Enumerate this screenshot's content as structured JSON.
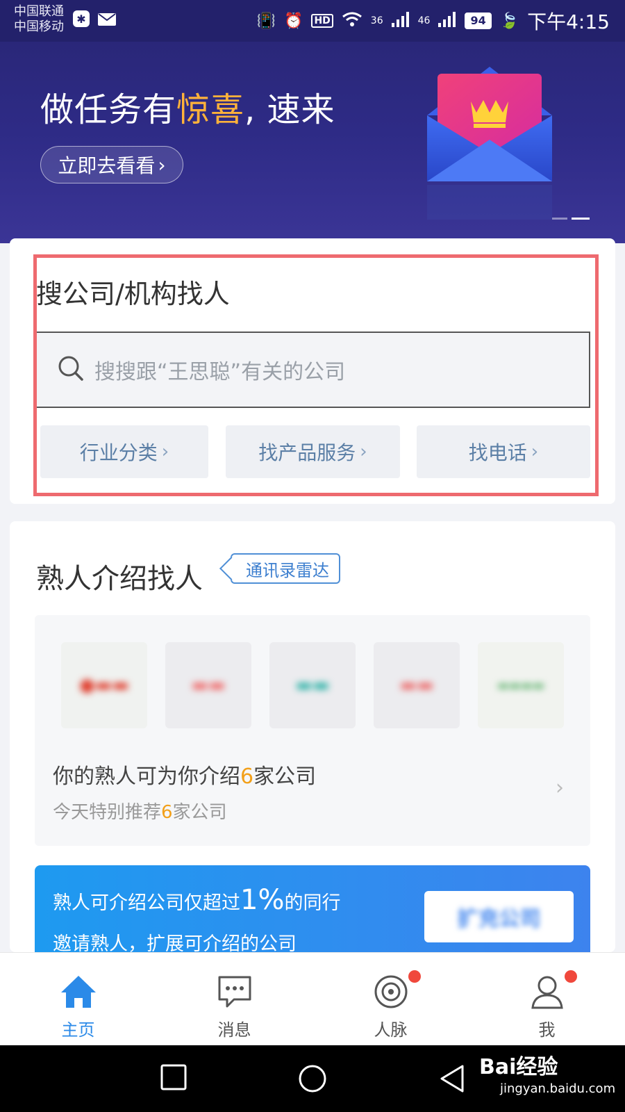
{
  "status_bar": {
    "carrier1": "中国联通",
    "carrier2": "中国移动",
    "network1": "36",
    "network2": "46",
    "hd": "HD",
    "battery": "94",
    "time": "下午4:15"
  },
  "banner": {
    "title_prefix": "做任务有",
    "title_highlight": "惊喜",
    "title_suffix": ", 速来",
    "button": "立即去看看",
    "button_chevron": "›"
  },
  "search_section": {
    "title": "搜公司/机构找人",
    "placeholder": "搜搜跟“王思聪”有关的公司",
    "chips": [
      "行业分类",
      "找产品服务",
      "找电话"
    ],
    "chip_chevron": "›"
  },
  "intro_section": {
    "title": "熟人介绍找人",
    "tag": "通讯录雷达",
    "main_prefix": "你的熟人可为你介绍",
    "main_count": "6",
    "main_suffix": "家公司",
    "sub_prefix": "今天特别推荐",
    "sub_count": "6",
    "sub_suffix": "家公司",
    "chevron": "›"
  },
  "promo": {
    "line1_prefix": "熟人可介绍公司仅超过",
    "line1_value": "1%",
    "line1_suffix": "的同行",
    "line2": "邀请熟人，扩展可介绍的公司",
    "button": "扩充公司"
  },
  "bottom_nav": {
    "items": [
      {
        "label": "主页",
        "icon": "home-icon",
        "active": true
      },
      {
        "label": "消息",
        "icon": "chat-icon",
        "active": false
      },
      {
        "label": "人脉",
        "icon": "network-icon",
        "active": false
      },
      {
        "label": "我",
        "icon": "user-icon",
        "active": false
      }
    ]
  },
  "watermark": {
    "brand": "Bai经验",
    "url": "jingyan.baidu.com"
  },
  "colors": {
    "banner_bg": "#2a2779",
    "accent_blue": "#2b8ae8",
    "highlight_orange": "#f2a01a",
    "annotation_red": "#ee6a6f"
  }
}
